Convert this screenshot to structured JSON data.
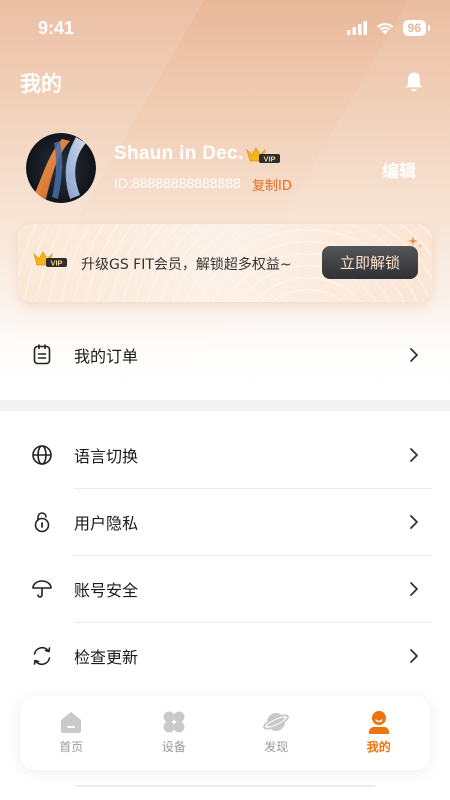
{
  "status_bar": {
    "time": "9:41",
    "battery": "96"
  },
  "header": {
    "title": "我的"
  },
  "profile": {
    "username": "Shaun in Dec.",
    "vip_badge": "VIP",
    "user_id": "ID:88888888888888",
    "copy_id_label": "复制ID",
    "edit_label": "编辑"
  },
  "vip_card": {
    "badge": "VIP",
    "text": "升级GS FIT会员，解锁超多权益~",
    "button_label": "立即解锁"
  },
  "orders": {
    "label": "我的订单"
  },
  "settings": {
    "items": [
      {
        "label": "语言切换",
        "icon": "globe-icon"
      },
      {
        "label": "用户隐私",
        "icon": "lock-icon"
      },
      {
        "label": "账号安全",
        "icon": "umbrella-icon"
      },
      {
        "label": "检查更新",
        "icon": "refresh-icon"
      }
    ]
  },
  "tabbar": {
    "tabs": [
      {
        "label": "首页",
        "icon": "home-icon"
      },
      {
        "label": "设备",
        "icon": "device-icon"
      },
      {
        "label": "发现",
        "icon": "planet-icon"
      },
      {
        "label": "我的",
        "icon": "profile-icon",
        "active": true
      }
    ]
  },
  "colors": {
    "accent": "#ee7410",
    "copy_id": "#e46d1c",
    "header_gradient_top": "#e9b89a"
  }
}
